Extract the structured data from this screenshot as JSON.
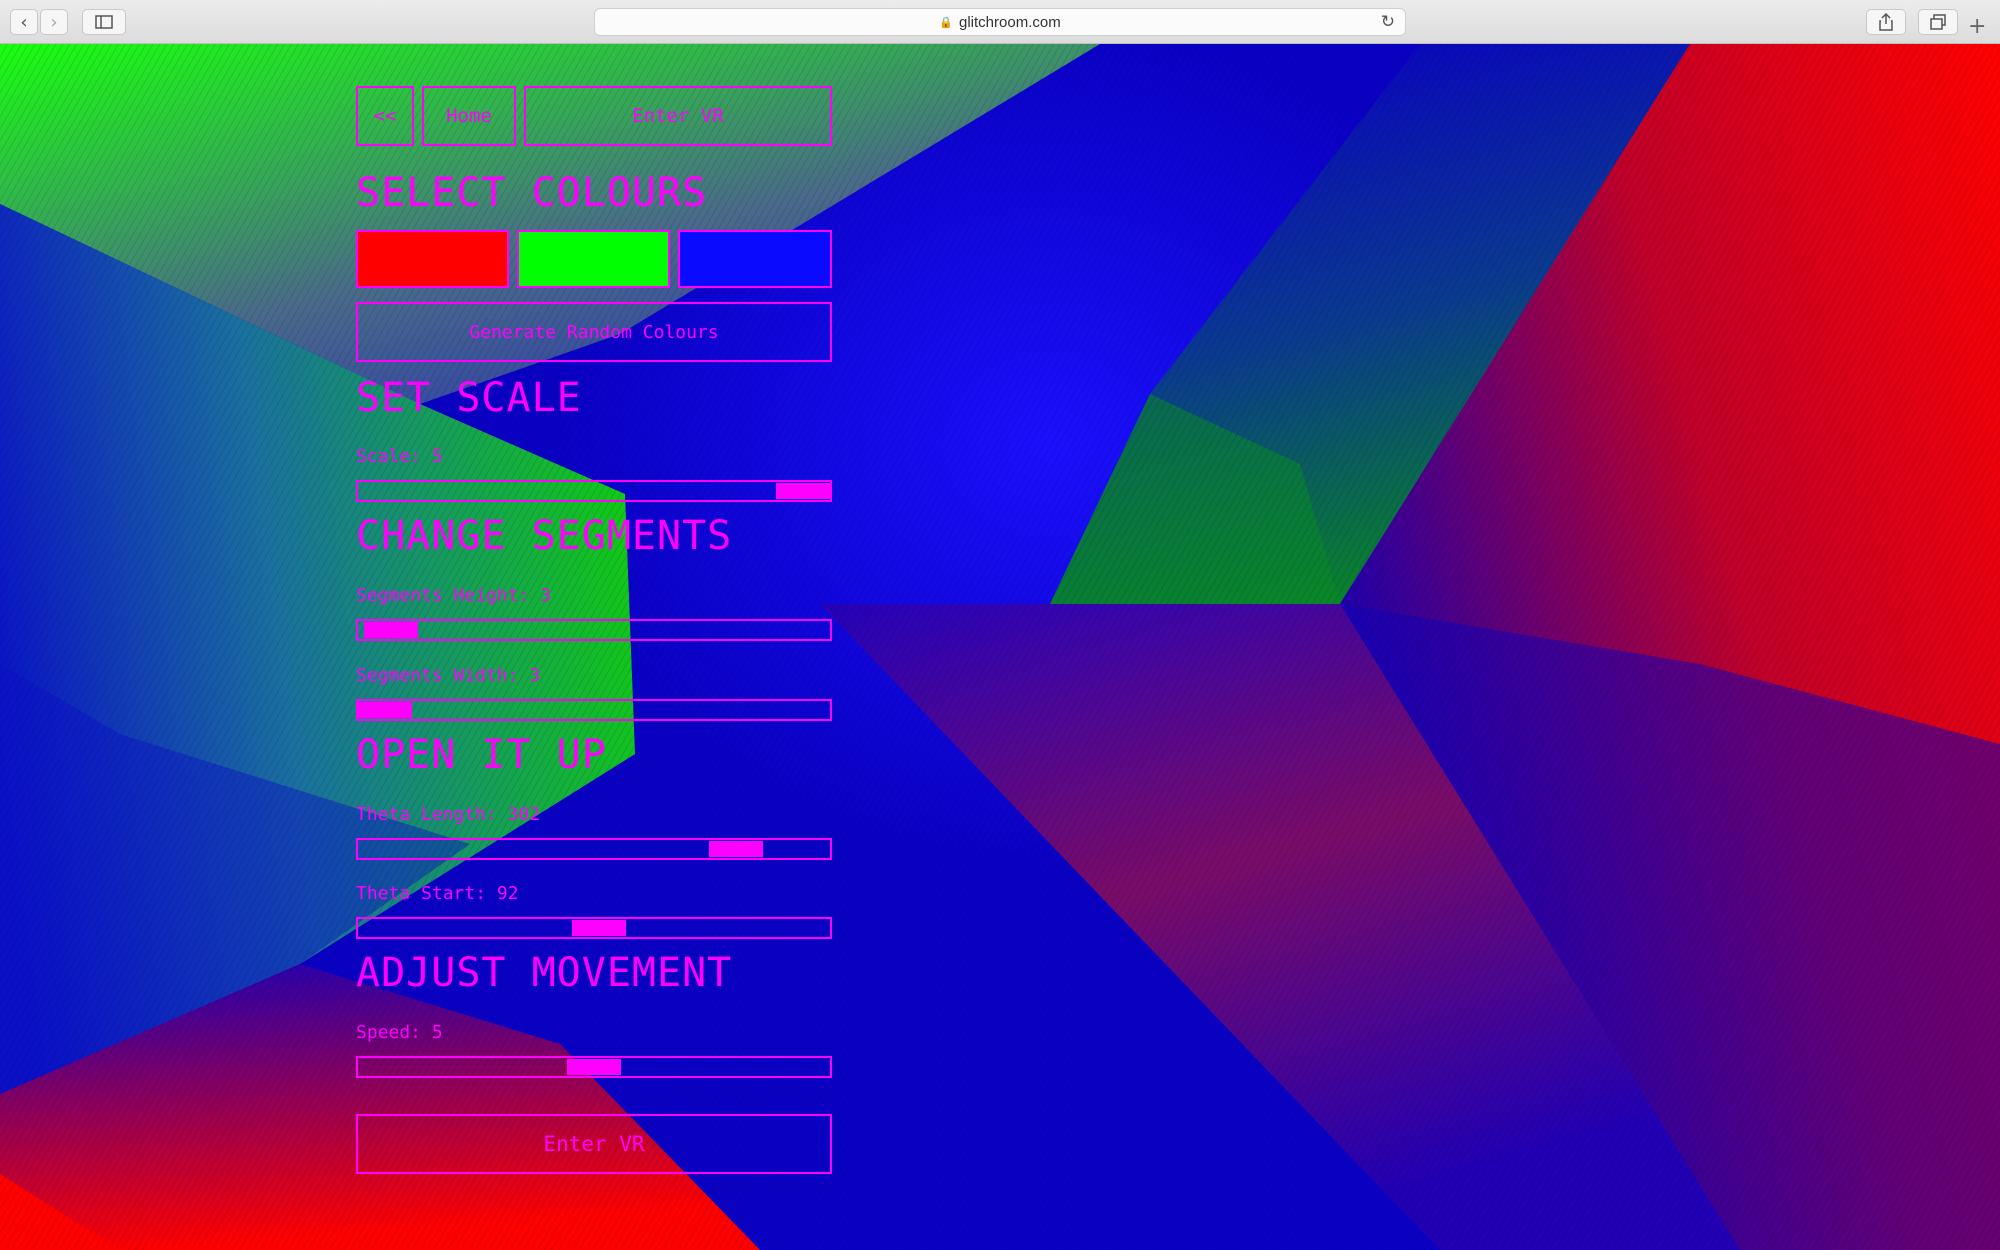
{
  "browser": {
    "url": "glitchroom.com"
  },
  "nav": {
    "back_label": "<<",
    "home_label": "Home",
    "vr_label": "Enter VR"
  },
  "colours": {
    "heading": "SELECT COLOURS",
    "swatches": [
      "#ff0000",
      "#00ff00",
      "#0a0aff"
    ],
    "random_label": "Generate Random Colours"
  },
  "scale": {
    "heading": "SET SCALE",
    "label": "Scale: 5",
    "fraction": 0.96
  },
  "segments": {
    "heading": "CHANGE SEGMENTS",
    "height_label": "Segments Height: 3",
    "height_fraction": 0.07,
    "width_label": "Segments Width: 3",
    "width_fraction": 0.05
  },
  "open": {
    "heading": "OPEN IT UP",
    "length_label": "Theta Length: 302",
    "length_fraction": 0.8,
    "start_label": "Theta Start: 92",
    "start_fraction": 0.51
  },
  "movement": {
    "heading": "ADJUST MOVEMENT",
    "speed_label": "Speed: 5",
    "speed_fraction": 0.5
  },
  "footer": {
    "vr_label": "Enter VR"
  }
}
